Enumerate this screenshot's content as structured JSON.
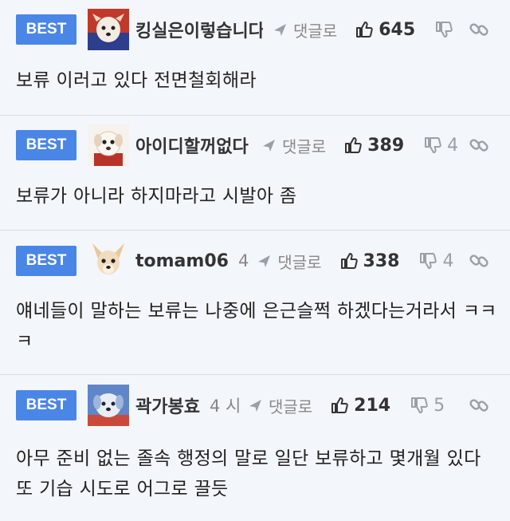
{
  "comments": [
    {
      "badge": "BEST",
      "avatar": "dog-avatar-red",
      "nickname": "킹실은이렇습니다",
      "time": "",
      "reply_label": "댓글로",
      "likes": "645",
      "dislikes": "",
      "text": "보류 이러고 있다 전면철회해라"
    },
    {
      "badge": "BEST",
      "avatar": "dog-avatar-white",
      "nickname": "아이디할꺼없다",
      "time": "",
      "reply_label": "댓글로",
      "likes": "389",
      "dislikes": "4",
      "text": "보류가 아니라 하지마라고 시발아 좀"
    },
    {
      "badge": "BEST",
      "avatar": "chihuahua-avatar",
      "nickname": "tomam06",
      "time": "4",
      "reply_label": "댓글로",
      "likes": "338",
      "dislikes": "4",
      "text": "얘네들이 말하는 보류는 나중에 은근슬쩍 하겠다는거라서 ㅋㅋㅋ"
    },
    {
      "badge": "BEST",
      "avatar": "dog-avatar-blue",
      "nickname": "곽가봉효",
      "time": "4 시",
      "reply_label": "댓글로",
      "likes": "214",
      "dislikes": "5",
      "text": "아무 준비 없는 졸속 행정의 말로 일단 보류하고 몇개월 있다 또 기습 시도로 어그로 끌듯"
    }
  ],
  "colors": {
    "background": "#f3f6fa",
    "best_badge": "#4a86e6",
    "divider": "#d9dde3",
    "muted_text": "#888888"
  }
}
